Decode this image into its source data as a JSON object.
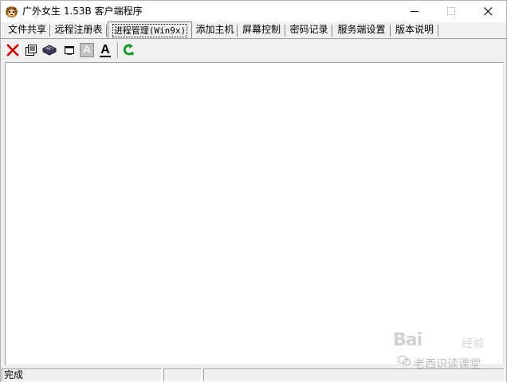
{
  "window": {
    "title": "广外女生 1.53B 客户端程序",
    "icon": "tiger-head-icon",
    "controls": [
      "minimize-icon",
      "maximize-icon",
      "close-icon"
    ]
  },
  "tabs": [
    {
      "label": "文件共享",
      "active": false
    },
    {
      "label": "远程注册表",
      "active": false
    },
    {
      "label": "进程管理(Win9x)",
      "active": true
    },
    {
      "label": "添加主机",
      "active": false
    },
    {
      "label": "屏幕控制",
      "active": false
    },
    {
      "label": "密码记录",
      "active": false
    },
    {
      "label": "服务端设置",
      "active": false
    },
    {
      "label": "版本说明",
      "active": false
    }
  ],
  "toolbar": {
    "buttons": [
      {
        "icon": "delete-x-icon",
        "color": "#cc0000"
      },
      {
        "icon": "document-icon"
      },
      {
        "icon": "process-list-icon"
      },
      {
        "icon": "window-icon"
      },
      {
        "icon": "font-a-gray-icon",
        "text": "A",
        "disabled": true
      },
      {
        "icon": "font-a-underline-icon",
        "text": "A"
      },
      {
        "icon": "refresh-icon",
        "color": "#1a9a2a"
      }
    ]
  },
  "status": {
    "text": "完成",
    "panes": [
      "完成",
      "",
      ""
    ]
  },
  "watermark": {
    "logo": "Bai",
    "logo_suffix": "经验",
    "author": "老西识读课堂"
  }
}
